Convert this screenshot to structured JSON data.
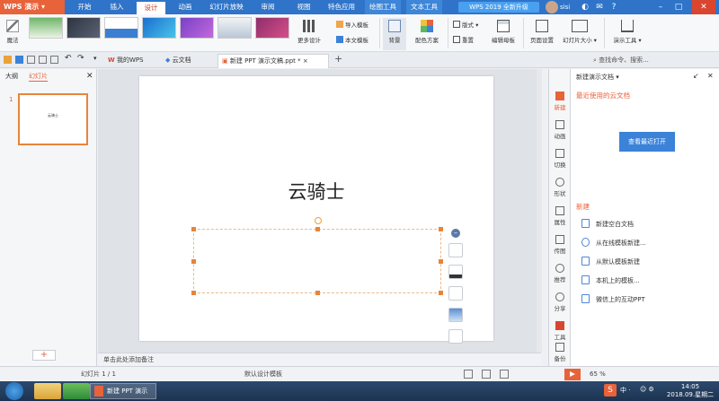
{
  "app": {
    "logo_text": "WPS 演示"
  },
  "menu_tabs": [
    "开始",
    "插入",
    "设计",
    "动画",
    "幻灯片放映",
    "审阅",
    "视图",
    "特色应用",
    "绘图工具",
    "文本工具"
  ],
  "active_menu_tab": "设计",
  "upgrade_label": "WPS 2019 全新升级",
  "user_name": "sisi",
  "ribbon": {
    "magic_label": "魔法",
    "more_design_label": "更多设计",
    "import_template_label": "导入模板",
    "this_template_label": "本文模板",
    "background_label": "背景",
    "color_scheme_label": "配色方案",
    "layout_label": "版式",
    "rearrange_label": "重置",
    "edit_master_label": "编辑母板",
    "page_setup_label": "页面设置",
    "slide_size_label": "幻灯片大小",
    "presenter_tools_label": "演示工具"
  },
  "doc_tabs": [
    "我的WPS",
    "云文档",
    "新建 PPT 演示文稿.ppt *"
  ],
  "search": {
    "placeholder": "查找命令、搜索..."
  },
  "left_panel": {
    "tab_outline": "大纲",
    "tab_slides": "幻灯片",
    "slide_number": "1",
    "thumb_text": "云骑士",
    "add_label": "+"
  },
  "slide": {
    "title": "云骑士"
  },
  "notes_placeholder": "单击此处添加备注",
  "sidebar": {
    "items": [
      "新建",
      "动画",
      "切换",
      "形状",
      "属性",
      "传图",
      "推荐",
      "分享",
      "工具",
      "备份"
    ]
  },
  "taskpane": {
    "title": "新建演示文档",
    "recent_label": "最近使用的云文档",
    "open_recent_button": "查看最近打开",
    "new_heading": "新建",
    "new_items": [
      "新建空白文档",
      "从在线模板新建...",
      "从默认模板新建",
      "本机上的模板...",
      "微信上的互动PPT"
    ]
  },
  "statusbar": {
    "slide_info": "幻灯片 1 / 1",
    "template_name": "默认设计模板",
    "zoom": "65 %"
  },
  "taskbar": {
    "wps_label": "新建 PPT 演示文...",
    "time": "14:05",
    "date": "2018.09.星期二"
  },
  "colors": {
    "menu_bg": "#2f74c8",
    "accent": "#e8623a",
    "button_blue": "#3b82d9"
  }
}
